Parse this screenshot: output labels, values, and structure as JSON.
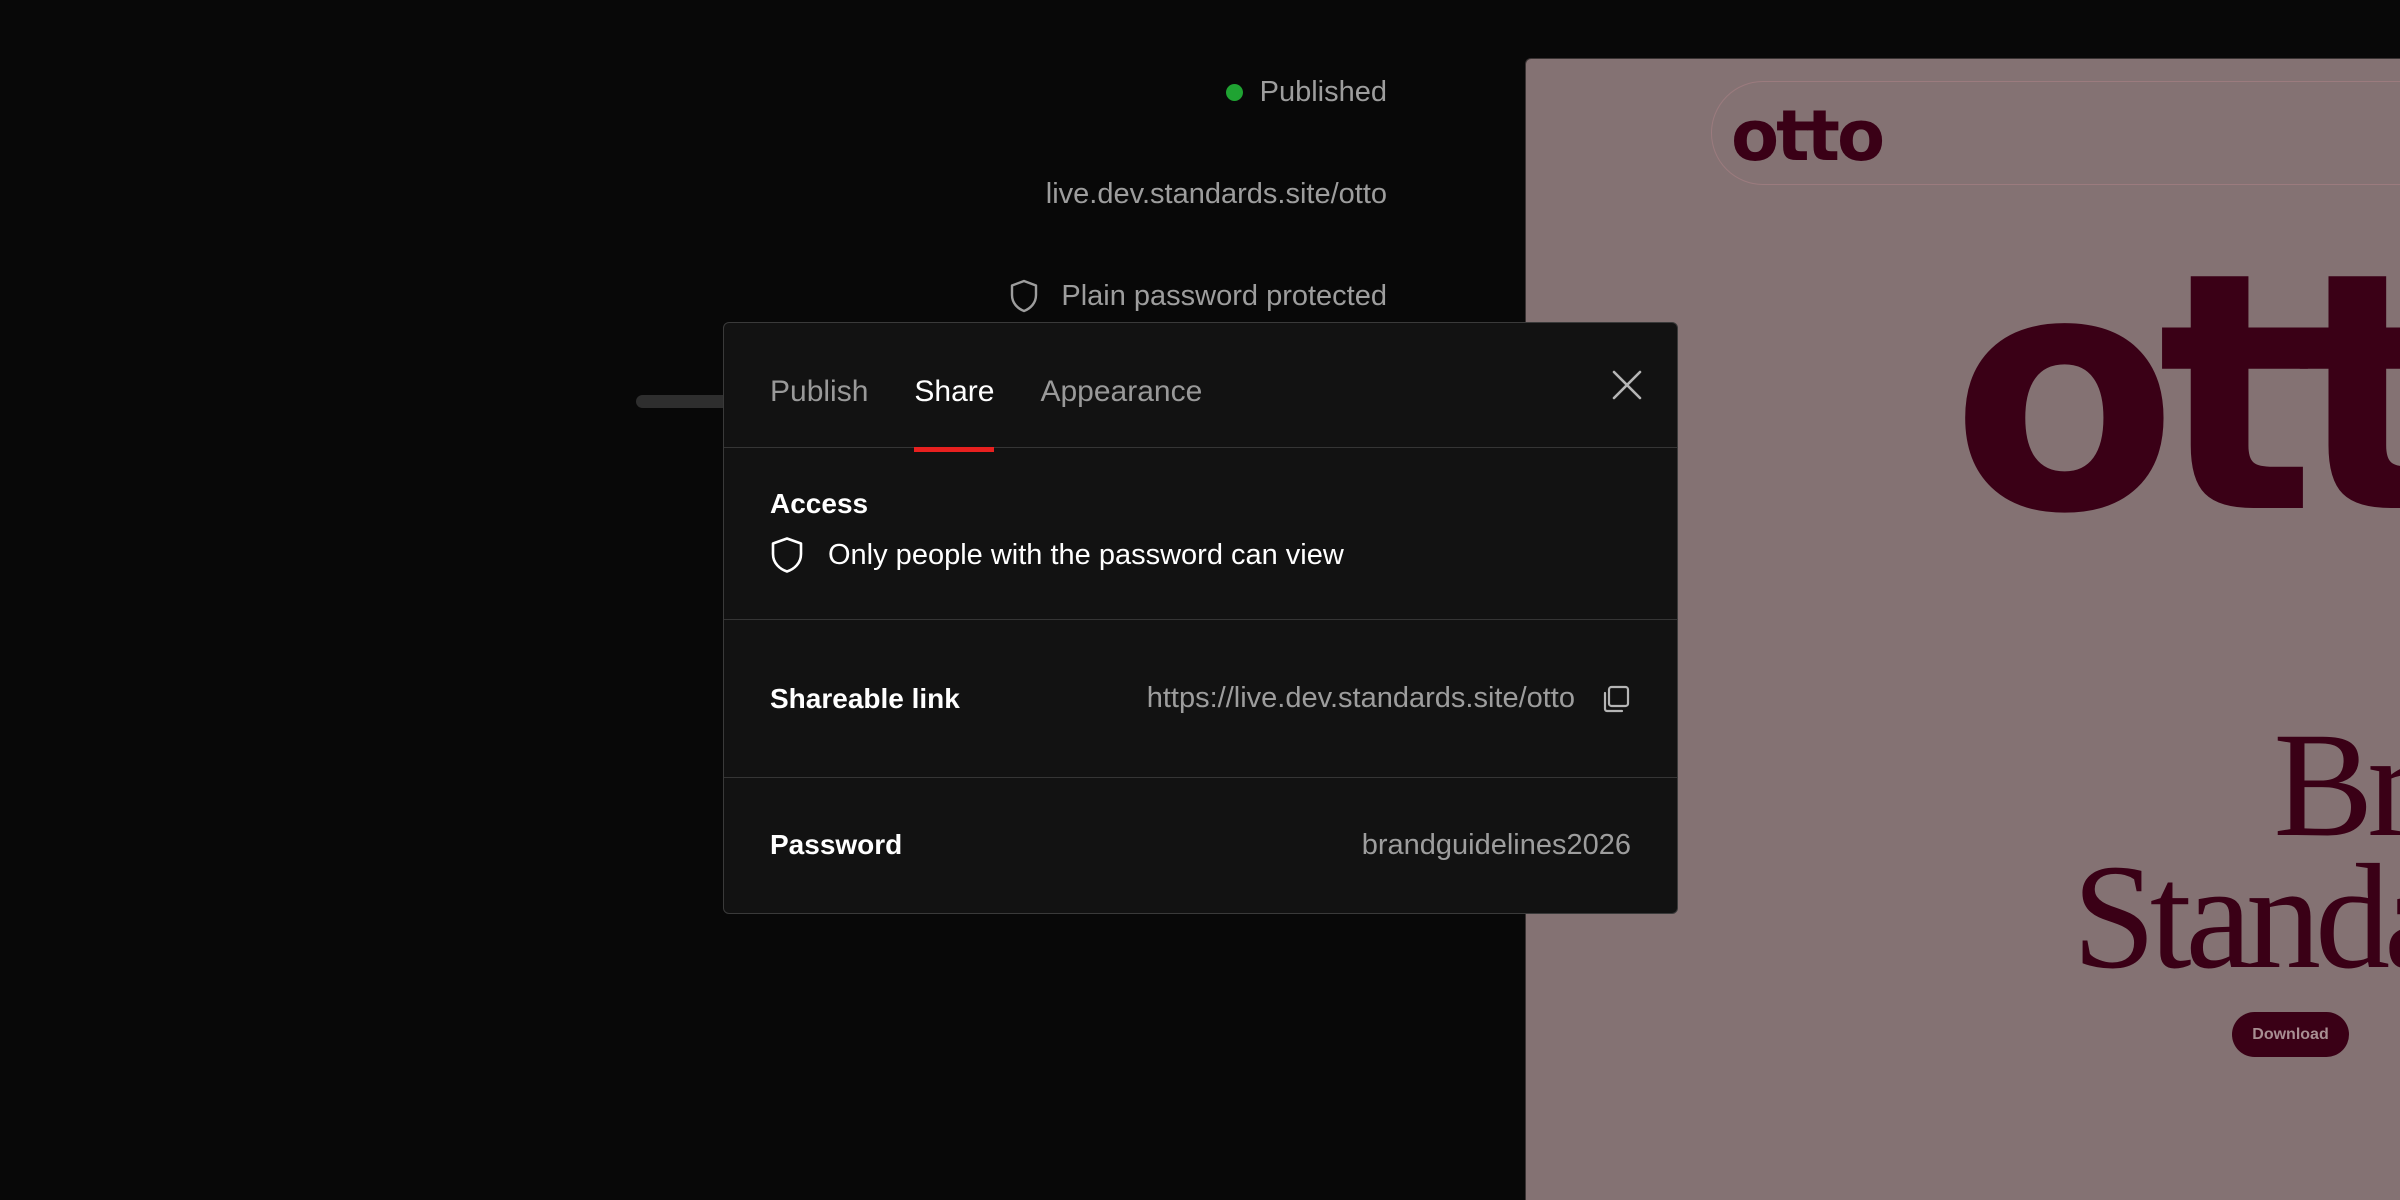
{
  "status": {
    "published_label": "Published",
    "site_url": "live.dev.standards.site/otto",
    "protection_label": "Plain password protected",
    "published_dot_color": "#1fa332"
  },
  "preview": {
    "logo_small": "otto",
    "logo_big": "otto",
    "hero_line1": "Brand",
    "hero_line2": "Standards",
    "download_label": "Download",
    "brand_color": "#3a0016",
    "background_color": "#847273"
  },
  "modal": {
    "tabs": [
      {
        "label": "Publish",
        "active": false
      },
      {
        "label": "Share",
        "active": true
      },
      {
        "label": "Appearance",
        "active": false
      }
    ],
    "close_icon": "close-icon",
    "access": {
      "title": "Access",
      "description": "Only people with the password can view",
      "icon": "shield-icon"
    },
    "shareable_link": {
      "label": "Shareable link",
      "value": "https://live.dev.standards.site/otto",
      "copy_icon": "copy-icon"
    },
    "password": {
      "label": "Password",
      "value": "brandguidelines2026"
    },
    "active_tab_indicator_color": "#e8201f"
  }
}
